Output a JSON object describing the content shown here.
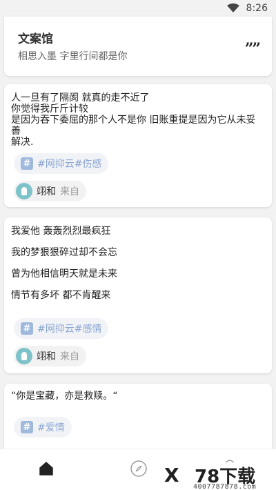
{
  "status_bar": {
    "time": "8:26"
  },
  "header": {
    "title": "文案馆",
    "subtitle": "相思入墨 字里行间都是你",
    "quote_glyph": "””"
  },
  "posts": [
    {
      "lines": [
        "人一旦有了隔阂 就真的走不近了",
        "你觉得我斤斤计较",
        "是因为吞下委屈的那个人不是你 旧账重提是因为它从未妥善",
        "解决."
      ],
      "tag": "#网抑云#伤感",
      "author": "翊和",
      "from_label": "来自"
    },
    {
      "lines": [
        "我爱他 轰轰烈烈最疯狂",
        "我的梦狠狠碎过却不会忘",
        "曾为他相信明天就是未来",
        "情节有多坏 都不肯醒来"
      ],
      "tag": "#网抑云#感情",
      "author": "翊和",
      "from_label": "来自"
    },
    {
      "lines": [
        "“你是宝藏，亦是救赎。“"
      ],
      "tag": "#爱情"
    }
  ],
  "tag_icon_glyph": "#",
  "bottom_nav": {
    "items": [
      {
        "icon": "home-icon"
      },
      {
        "icon": "compass-icon"
      },
      {
        "icon": "profile-icon"
      }
    ]
  },
  "watermark": {
    "brand": "78下载",
    "url": "4007787878.com"
  },
  "colors": {
    "tag_bg": "#f1f3f7",
    "tag_text": "#8aa6d2",
    "tag_icon": "#9fb9dd",
    "avatar": "#7ec3c9"
  }
}
